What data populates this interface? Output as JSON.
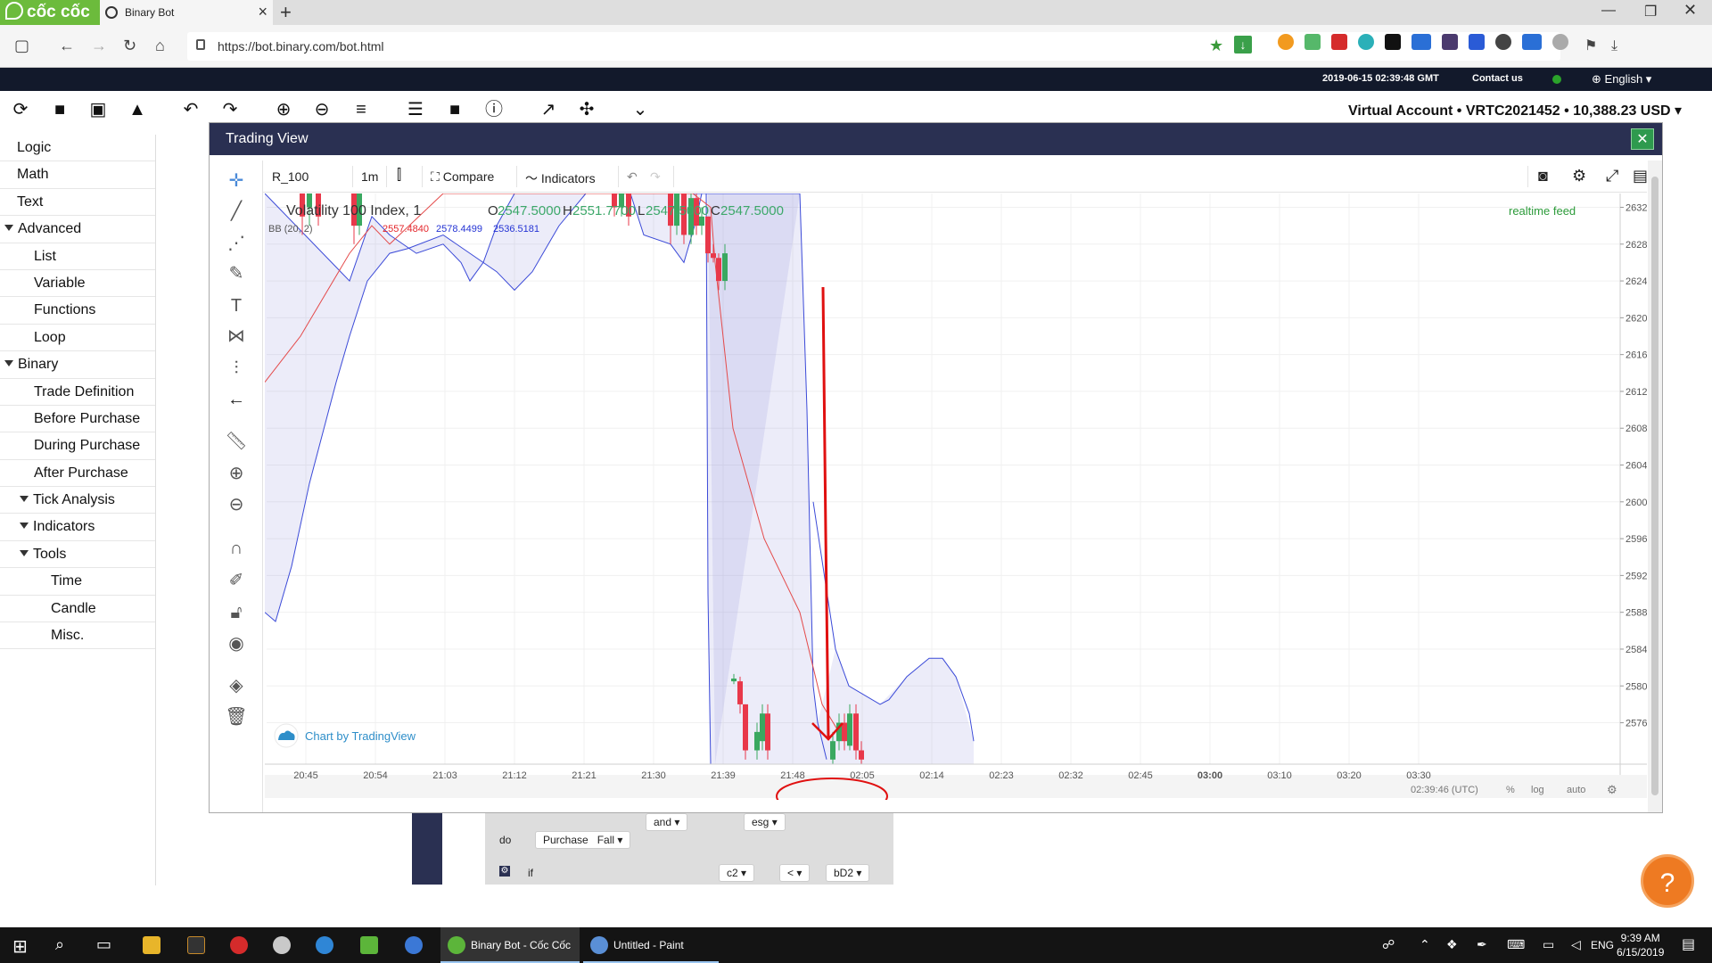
{
  "browser": {
    "brand": "cốc cốc",
    "tab_title": "Binary Bot",
    "url": "https://bot.binary.com/bot.html"
  },
  "site_header": {
    "datetime": "2019-06-15 02:39:48 GMT",
    "contact": "Contact us",
    "language": "English"
  },
  "toolbar": {
    "account": "Virtual Account  •  VRTC2021452  •  10,388.23 USD"
  },
  "menu": [
    {
      "label": "Logic",
      "indent": 0,
      "arrow": false
    },
    {
      "label": "Math",
      "indent": 0,
      "arrow": false
    },
    {
      "label": "Text",
      "indent": 0,
      "arrow": false
    },
    {
      "label": "Advanced",
      "indent": 0,
      "arrow": true
    },
    {
      "label": "List",
      "indent": 1,
      "arrow": false
    },
    {
      "label": "Variable",
      "indent": 1,
      "arrow": false
    },
    {
      "label": "Functions",
      "indent": 1,
      "arrow": false
    },
    {
      "label": "Loop",
      "indent": 1,
      "arrow": false
    },
    {
      "label": "Binary",
      "indent": 0,
      "arrow": true
    },
    {
      "label": "Trade Definition",
      "indent": 1,
      "arrow": false
    },
    {
      "label": "Before Purchase",
      "indent": 1,
      "arrow": false
    },
    {
      "label": "During Purchase",
      "indent": 1,
      "arrow": false
    },
    {
      "label": "After Purchase",
      "indent": 1,
      "arrow": false
    },
    {
      "label": "Tick Analysis",
      "indent": 1,
      "arrow": true
    },
    {
      "label": "Indicators",
      "indent": 1,
      "arrow": true
    },
    {
      "label": "Tools",
      "indent": 1,
      "arrow": true
    },
    {
      "label": "Time",
      "indent": 2,
      "arrow": false
    },
    {
      "label": "Candle",
      "indent": 2,
      "arrow": false
    },
    {
      "label": "Misc.",
      "indent": 2,
      "arrow": false
    }
  ],
  "dialog": {
    "title": "Trading View",
    "symbol": "R_100",
    "interval": "1m",
    "compare": "Compare",
    "indicators": "Indicators",
    "legend_title": "Volatility 100 Index, 1",
    "ohlc": {
      "o": "2547.5000",
      "h": "2551.7700",
      "l": "2547.5000",
      "c": "2547.5000"
    },
    "bb_label": "BB (20, 2)",
    "bb_values": [
      "2557.4840",
      "2578.4499",
      "2536.5181"
    ],
    "realtime": "realtime feed",
    "attribution": "Chart by TradingView",
    "footer_time": "02:39:46 (UTC)",
    "footer_pct": "%",
    "footer_log": "log",
    "footer_auto": "auto"
  },
  "chart_data": {
    "type": "candlestick",
    "ylim": [
      2571.5,
      2633.5
    ],
    "y_ticks": [
      2576,
      2580,
      2584,
      2588,
      2592,
      2596,
      2600,
      2604,
      2608,
      2612,
      2616,
      2620,
      2624,
      2628,
      2632
    ],
    "y_tick_labels": [
      "2576.0000",
      "2580.0000",
      "2584.0000",
      "2588.0000",
      "2592.0000",
      "2596.0000",
      "2600.0000",
      "2604.0000",
      "2608.0000",
      "2612.0000",
      "2616.0000",
      "2620.0000",
      "2624.0000",
      "2628.0000",
      "2632.0000"
    ],
    "x_ticks": [
      "20:45",
      "20:54",
      "21:03",
      "21:12",
      "21:21",
      "21:30",
      "21:39",
      "21:48",
      "02:05",
      "02:14",
      "02:23",
      "02:32",
      "02:45",
      "03:00",
      "03:10",
      "03:20",
      "03:30"
    ],
    "bollinger": {
      "upper": [
        [
          0,
          2640
        ],
        [
          95,
          2624
        ],
        [
          120,
          2631
        ],
        [
          140,
          2629
        ],
        [
          170,
          2627
        ],
        [
          200,
          2628
        ],
        [
          220,
          2626
        ],
        [
          230,
          2624
        ],
        [
          245,
          2626
        ],
        [
          260,
          2630
        ],
        [
          280,
          2634
        ],
        [
          410,
          2634
        ],
        [
          425,
          2629
        ],
        [
          455,
          2628
        ],
        [
          470,
          2626
        ],
        [
          482,
          2630
        ],
        [
          490,
          2634
        ],
        [
          600,
          2634
        ],
        [
          608,
          2610
        ],
        [
          615,
          2580
        ],
        [
          620,
          2576
        ],
        [
          630,
          2572
        ]
      ],
      "middle": [
        [
          0,
          2613
        ],
        [
          40,
          2618
        ],
        [
          95,
          2627
        ],
        [
          120,
          2630
        ],
        [
          140,
          2628
        ],
        [
          200,
          2634
        ],
        [
          480,
          2634
        ],
        [
          500,
          2632
        ],
        [
          505,
          2626
        ],
        [
          525,
          2608
        ],
        [
          560,
          2596
        ],
        [
          600,
          2588
        ],
        [
          625,
          2578
        ],
        [
          650,
          2574
        ]
      ],
      "lower": [
        [
          0,
          2588
        ],
        [
          12,
          2587
        ],
        [
          30,
          2593
        ],
        [
          50,
          2602
        ],
        [
          80,
          2613
        ],
        [
          95,
          2618
        ],
        [
          115,
          2624
        ],
        [
          140,
          2627
        ],
        [
          160,
          2627.5
        ],
        [
          200,
          2629
        ],
        [
          230,
          2627
        ],
        [
          260,
          2625
        ],
        [
          280,
          2623
        ],
        [
          300,
          2625
        ],
        [
          330,
          2630
        ],
        [
          360,
          2634
        ],
        [
          495,
          2634
        ],
        [
          497,
          2590
        ],
        [
          500,
          2560
        ],
        [
          505,
          2540
        ]
      ],
      "lower2": [
        [
          615,
          2600
        ],
        [
          640,
          2584
        ],
        [
          655,
          2580
        ],
        [
          690,
          2578
        ],
        [
          700,
          2578.5
        ],
        [
          720,
          2581
        ],
        [
          745,
          2583
        ],
        [
          760,
          2583
        ],
        [
          775,
          2581
        ],
        [
          790,
          2577
        ],
        [
          795,
          2574
        ]
      ]
    },
    "candles": [
      {
        "x": 42,
        "o": 2634,
        "c": 2631,
        "h": 2634,
        "l": 2629
      },
      {
        "x": 50,
        "o": 2632,
        "c": 2634,
        "h": 2634,
        "l": 2630
      },
      {
        "x": 60,
        "o": 2634,
        "c": 2631,
        "h": 2634,
        "l": 2630
      },
      {
        "x": 100,
        "o": 2634,
        "c": 2630,
        "h": 2634,
        "l": 2628
      },
      {
        "x": 106,
        "o": 2630,
        "c": 2634,
        "h": 2634,
        "l": 2629
      },
      {
        "x": 392,
        "o": 2634,
        "c": 2632,
        "h": 2634,
        "l": 2631
      },
      {
        "x": 400,
        "o": 2632,
        "c": 2634,
        "h": 2634,
        "l": 2631
      },
      {
        "x": 408,
        "o": 2634,
        "c": 2631,
        "h": 2634,
        "l": 2630
      },
      {
        "x": 455,
        "o": 2634,
        "c": 2630,
        "h": 2634,
        "l": 2628
      },
      {
        "x": 462,
        "o": 2630,
        "c": 2634,
        "h": 2634,
        "l": 2629
      },
      {
        "x": 470,
        "o": 2634,
        "c": 2629,
        "h": 2634,
        "l": 2628
      },
      {
        "x": 478,
        "o": 2629,
        "c": 2633,
        "h": 2634,
        "l": 2628
      },
      {
        "x": 484,
        "o": 2633,
        "c": 2630,
        "h": 2634,
        "l": 2629
      },
      {
        "x": 490,
        "o": 2630,
        "c": 2631,
        "h": 2632,
        "l": 2629
      },
      {
        "x": 497,
        "o": 2631,
        "c": 2627,
        "h": 2631,
        "l": 2626
      },
      {
        "x": 503,
        "o": 2627,
        "c": 2626.5,
        "h": 2628,
        "l": 2626
      },
      {
        "x": 509,
        "o": 2626.5,
        "c": 2624,
        "h": 2627,
        "l": 2623
      },
      {
        "x": 516,
        "o": 2624,
        "c": 2627,
        "h": 2628,
        "l": 2623
      },
      {
        "x": 526,
        "o": 2580.5,
        "c": 2580.8,
        "h": 2581.3,
        "l": 2580.2
      },
      {
        "x": 533,
        "o": 2580.5,
        "c": 2578,
        "h": 2581,
        "l": 2577
      },
      {
        "x": 539,
        "o": 2578,
        "c": 2573,
        "h": 2578,
        "l": 2572
      },
      {
        "x": 552,
        "o": 2573,
        "c": 2575,
        "h": 2576,
        "l": 2572
      },
      {
        "x": 558,
        "o": 2574,
        "c": 2577,
        "h": 2578,
        "l": 2573
      },
      {
        "x": 564,
        "o": 2577,
        "c": 2573,
        "h": 2578,
        "l": 2572
      },
      {
        "x": 637,
        "o": 2572,
        "c": 2574,
        "h": 2575,
        "l": 2571.5
      },
      {
        "x": 644,
        "o": 2574,
        "c": 2576,
        "h": 2577,
        "l": 2573
      },
      {
        "x": 650,
        "o": 2576,
        "c": 2574,
        "h": 2577,
        "l": 2573
      },
      {
        "x": 656,
        "o": 2573.5,
        "c": 2577,
        "h": 2578,
        "l": 2573
      },
      {
        "x": 663,
        "o": 2577,
        "c": 2573,
        "h": 2578,
        "l": 2572
      },
      {
        "x": 669,
        "o": 2573,
        "c": 2572,
        "h": 2574,
        "l": 2571.5
      }
    ]
  },
  "workspace": {
    "and": "and",
    "esg": "esg",
    "do": "do",
    "purchase": "Purchase",
    "fall": "Fall",
    "if": "if",
    "c2": "c2",
    "lt": "<",
    "bd2": "bD2"
  },
  "help": "?",
  "taskbar": {
    "task1": "Binary Bot - Cốc Cốc",
    "task2": "Untitled - Paint",
    "lang": "ENG",
    "time": "9:39 AM",
    "date": "6/15/2019"
  }
}
